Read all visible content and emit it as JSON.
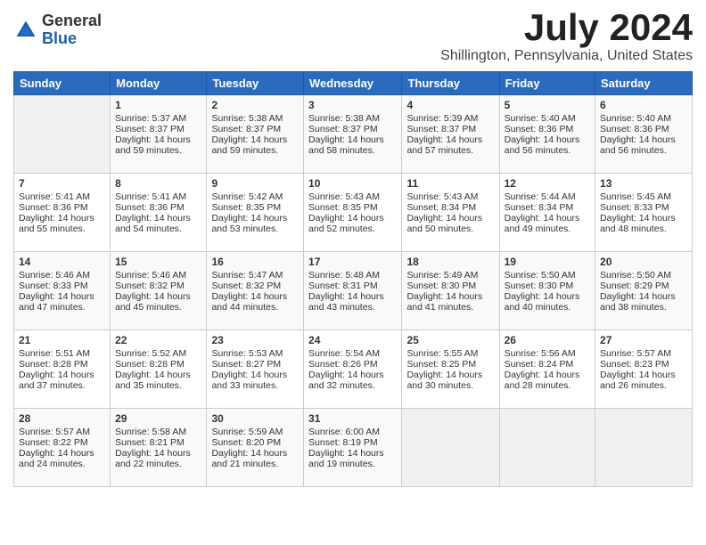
{
  "header": {
    "logo_general": "General",
    "logo_blue": "Blue",
    "month_title": "July 2024",
    "location": "Shillington, Pennsylvania, United States"
  },
  "days_of_week": [
    "Sunday",
    "Monday",
    "Tuesday",
    "Wednesday",
    "Thursday",
    "Friday",
    "Saturday"
  ],
  "weeks": [
    [
      {
        "day": "",
        "empty": true
      },
      {
        "day": "1",
        "sunrise": "Sunrise: 5:37 AM",
        "sunset": "Sunset: 8:37 PM",
        "daylight": "Daylight: 14 hours and 59 minutes."
      },
      {
        "day": "2",
        "sunrise": "Sunrise: 5:38 AM",
        "sunset": "Sunset: 8:37 PM",
        "daylight": "Daylight: 14 hours and 59 minutes."
      },
      {
        "day": "3",
        "sunrise": "Sunrise: 5:38 AM",
        "sunset": "Sunset: 8:37 PM",
        "daylight": "Daylight: 14 hours and 58 minutes."
      },
      {
        "day": "4",
        "sunrise": "Sunrise: 5:39 AM",
        "sunset": "Sunset: 8:37 PM",
        "daylight": "Daylight: 14 hours and 57 minutes."
      },
      {
        "day": "5",
        "sunrise": "Sunrise: 5:40 AM",
        "sunset": "Sunset: 8:36 PM",
        "daylight": "Daylight: 14 hours and 56 minutes."
      },
      {
        "day": "6",
        "sunrise": "Sunrise: 5:40 AM",
        "sunset": "Sunset: 8:36 PM",
        "daylight": "Daylight: 14 hours and 56 minutes."
      }
    ],
    [
      {
        "day": "7",
        "sunrise": "Sunrise: 5:41 AM",
        "sunset": "Sunset: 8:36 PM",
        "daylight": "Daylight: 14 hours and 55 minutes."
      },
      {
        "day": "8",
        "sunrise": "Sunrise: 5:41 AM",
        "sunset": "Sunset: 8:36 PM",
        "daylight": "Daylight: 14 hours and 54 minutes."
      },
      {
        "day": "9",
        "sunrise": "Sunrise: 5:42 AM",
        "sunset": "Sunset: 8:35 PM",
        "daylight": "Daylight: 14 hours and 53 minutes."
      },
      {
        "day": "10",
        "sunrise": "Sunrise: 5:43 AM",
        "sunset": "Sunset: 8:35 PM",
        "daylight": "Daylight: 14 hours and 52 minutes."
      },
      {
        "day": "11",
        "sunrise": "Sunrise: 5:43 AM",
        "sunset": "Sunset: 8:34 PM",
        "daylight": "Daylight: 14 hours and 50 minutes."
      },
      {
        "day": "12",
        "sunrise": "Sunrise: 5:44 AM",
        "sunset": "Sunset: 8:34 PM",
        "daylight": "Daylight: 14 hours and 49 minutes."
      },
      {
        "day": "13",
        "sunrise": "Sunrise: 5:45 AM",
        "sunset": "Sunset: 8:33 PM",
        "daylight": "Daylight: 14 hours and 48 minutes."
      }
    ],
    [
      {
        "day": "14",
        "sunrise": "Sunrise: 5:46 AM",
        "sunset": "Sunset: 8:33 PM",
        "daylight": "Daylight: 14 hours and 47 minutes."
      },
      {
        "day": "15",
        "sunrise": "Sunrise: 5:46 AM",
        "sunset": "Sunset: 8:32 PM",
        "daylight": "Daylight: 14 hours and 45 minutes."
      },
      {
        "day": "16",
        "sunrise": "Sunrise: 5:47 AM",
        "sunset": "Sunset: 8:32 PM",
        "daylight": "Daylight: 14 hours and 44 minutes."
      },
      {
        "day": "17",
        "sunrise": "Sunrise: 5:48 AM",
        "sunset": "Sunset: 8:31 PM",
        "daylight": "Daylight: 14 hours and 43 minutes."
      },
      {
        "day": "18",
        "sunrise": "Sunrise: 5:49 AM",
        "sunset": "Sunset: 8:30 PM",
        "daylight": "Daylight: 14 hours and 41 minutes."
      },
      {
        "day": "19",
        "sunrise": "Sunrise: 5:50 AM",
        "sunset": "Sunset: 8:30 PM",
        "daylight": "Daylight: 14 hours and 40 minutes."
      },
      {
        "day": "20",
        "sunrise": "Sunrise: 5:50 AM",
        "sunset": "Sunset: 8:29 PM",
        "daylight": "Daylight: 14 hours and 38 minutes."
      }
    ],
    [
      {
        "day": "21",
        "sunrise": "Sunrise: 5:51 AM",
        "sunset": "Sunset: 8:28 PM",
        "daylight": "Daylight: 14 hours and 37 minutes."
      },
      {
        "day": "22",
        "sunrise": "Sunrise: 5:52 AM",
        "sunset": "Sunset: 8:28 PM",
        "daylight": "Daylight: 14 hours and 35 minutes."
      },
      {
        "day": "23",
        "sunrise": "Sunrise: 5:53 AM",
        "sunset": "Sunset: 8:27 PM",
        "daylight": "Daylight: 14 hours and 33 minutes."
      },
      {
        "day": "24",
        "sunrise": "Sunrise: 5:54 AM",
        "sunset": "Sunset: 8:26 PM",
        "daylight": "Daylight: 14 hours and 32 minutes."
      },
      {
        "day": "25",
        "sunrise": "Sunrise: 5:55 AM",
        "sunset": "Sunset: 8:25 PM",
        "daylight": "Daylight: 14 hours and 30 minutes."
      },
      {
        "day": "26",
        "sunrise": "Sunrise: 5:56 AM",
        "sunset": "Sunset: 8:24 PM",
        "daylight": "Daylight: 14 hours and 28 minutes."
      },
      {
        "day": "27",
        "sunrise": "Sunrise: 5:57 AM",
        "sunset": "Sunset: 8:23 PM",
        "daylight": "Daylight: 14 hours and 26 minutes."
      }
    ],
    [
      {
        "day": "28",
        "sunrise": "Sunrise: 5:57 AM",
        "sunset": "Sunset: 8:22 PM",
        "daylight": "Daylight: 14 hours and 24 minutes."
      },
      {
        "day": "29",
        "sunrise": "Sunrise: 5:58 AM",
        "sunset": "Sunset: 8:21 PM",
        "daylight": "Daylight: 14 hours and 22 minutes."
      },
      {
        "day": "30",
        "sunrise": "Sunrise: 5:59 AM",
        "sunset": "Sunset: 8:20 PM",
        "daylight": "Daylight: 14 hours and 21 minutes."
      },
      {
        "day": "31",
        "sunrise": "Sunrise: 6:00 AM",
        "sunset": "Sunset: 8:19 PM",
        "daylight": "Daylight: 14 hours and 19 minutes."
      },
      {
        "day": "",
        "empty": true
      },
      {
        "day": "",
        "empty": true
      },
      {
        "day": "",
        "empty": true
      }
    ]
  ]
}
